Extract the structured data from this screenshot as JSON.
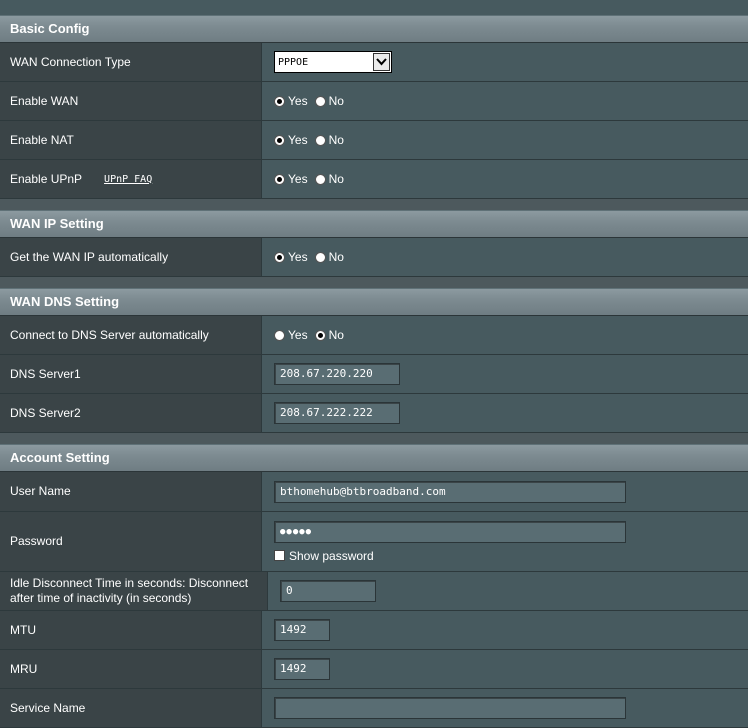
{
  "basic": {
    "title": "Basic Config",
    "wan_type_label": "WAN Connection Type",
    "wan_type_value": "PPPOE",
    "enable_wan_label": "Enable WAN",
    "enable_nat_label": "Enable NAT",
    "enable_upnp_label": "Enable UPnP",
    "upnp_faq": "UPnP FAQ"
  },
  "radio": {
    "yes": "Yes",
    "no": "No"
  },
  "wan_ip": {
    "title": "WAN IP Setting",
    "auto_label": "Get the WAN IP automatically"
  },
  "wan_dns": {
    "title": "WAN DNS Setting",
    "auto_label": "Connect to DNS Server automatically",
    "dns1_label": "DNS Server1",
    "dns1_value": "208.67.220.220",
    "dns2_label": "DNS Server2",
    "dns2_value": "208.67.222.222"
  },
  "account": {
    "title": "Account Setting",
    "user_label": "User Name",
    "user_value": "bthomehub@btbroadband.com",
    "password_label": "Password",
    "password_value": "●●●●●",
    "show_password": "Show password",
    "idle_label": "Idle Disconnect Time in seconds: Disconnect after time of inactivity (in seconds)",
    "idle_value": "0",
    "mtu_label": "MTU",
    "mtu_value": "1492",
    "mru_label": "MRU",
    "mru_value": "1492",
    "service_label": "Service Name",
    "service_value": ""
  },
  "selected": {
    "enable_wan": "yes",
    "enable_nat": "yes",
    "enable_upnp": "yes",
    "wan_ip_auto": "yes",
    "dns_auto": "no"
  }
}
